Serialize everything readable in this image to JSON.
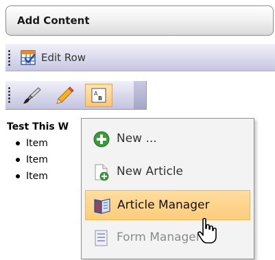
{
  "add_content": {
    "label": "Add Content"
  },
  "edit_row": {
    "label": "Edit Row"
  },
  "toolbar": {
    "tools": [
      {
        "icon": "paintbrush-icon"
      },
      {
        "icon": "pencil-icon"
      },
      {
        "icon": "text-box-icon",
        "state": "active"
      }
    ]
  },
  "content": {
    "heading": "Test This W",
    "items": [
      "Item",
      "Item",
      "Item"
    ]
  },
  "menu": {
    "items": [
      {
        "label": "New ...",
        "icon": "green-plus-icon",
        "state": "normal"
      },
      {
        "label": "New Article",
        "icon": "new-document-icon",
        "state": "normal"
      },
      {
        "label": "Article Manager",
        "icon": "book-icon",
        "state": "hover"
      },
      {
        "label": "Form Manager",
        "icon": "form-icon",
        "state": "disabled"
      }
    ]
  },
  "colors": {
    "menu_highlight": "#fccd7c",
    "toolbar_blue": "#c6c6e1",
    "plus_green": "#3a9b3a"
  }
}
